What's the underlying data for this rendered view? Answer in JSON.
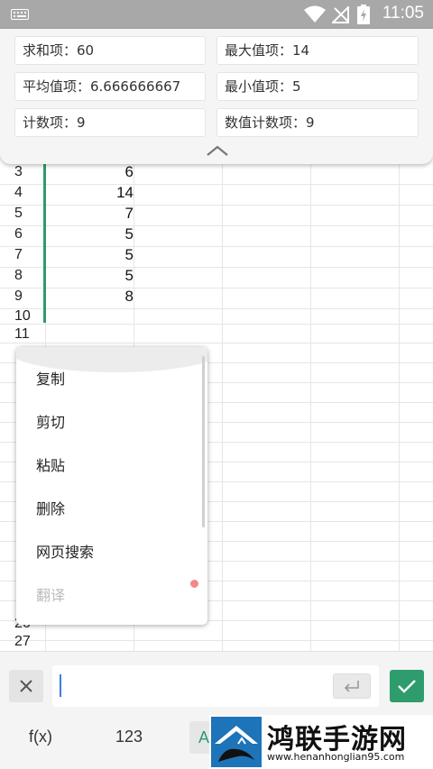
{
  "status_bar": {
    "time": "11:05"
  },
  "stats": {
    "sum": "求和项：60",
    "max": "最大值项：14",
    "average": "平均值项：6.666666667",
    "min": "最小值项：5",
    "count": "计数项：9",
    "numeric_count": "数值计数项：9"
  },
  "sheet": {
    "rows": [
      {
        "num": "3",
        "value": "6"
      },
      {
        "num": "4",
        "value": "14"
      },
      {
        "num": "5",
        "value": "7"
      },
      {
        "num": "6",
        "value": "5"
      },
      {
        "num": "7",
        "value": "5"
      },
      {
        "num": "8",
        "value": "5"
      },
      {
        "num": "9",
        "value": "8"
      },
      {
        "num": "10",
        "value": ""
      },
      {
        "num": "11",
        "value": ""
      }
    ],
    "bottom_rows": [
      "26",
      "27"
    ]
  },
  "context_menu": {
    "items": [
      "复制",
      "剪切",
      "粘贴",
      "删除",
      "网页搜索",
      "翻译"
    ]
  },
  "keyboard": {
    "fx": "f(x)",
    "numeric": "123",
    "alpha": "A"
  },
  "watermark": {
    "name": "鸿联手游网",
    "url": "www.henanhonglian95.com"
  },
  "colors": {
    "accent": "#2e9c6d",
    "caret": "#3b7de0"
  }
}
